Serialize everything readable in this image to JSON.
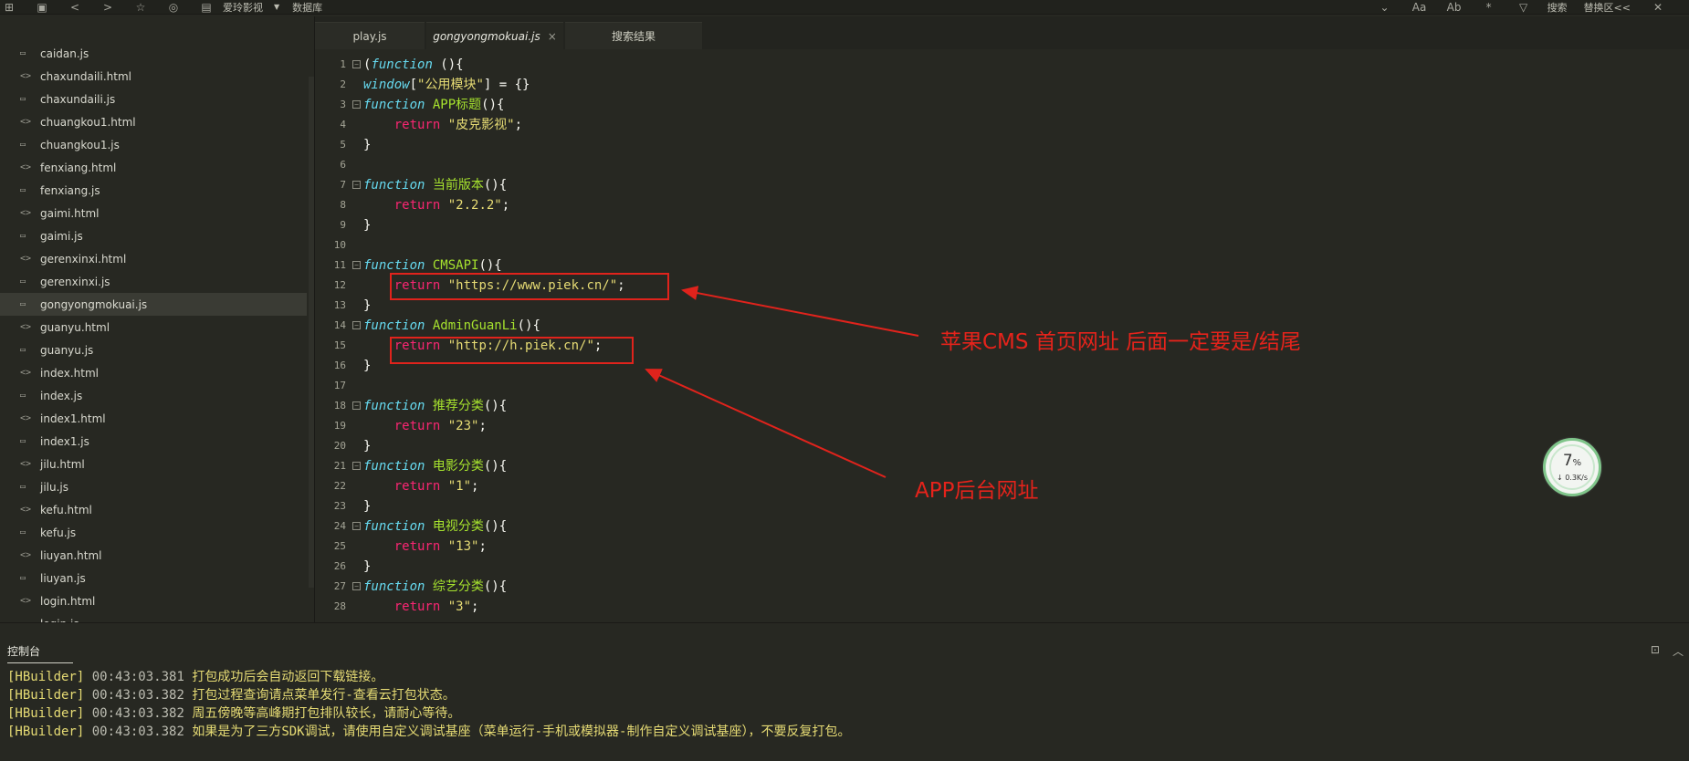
{
  "toolbar": {
    "project_name": "爱玲影视",
    "database_label": "数据库",
    "search_label": "搜索",
    "switch_label": "替换区<<"
  },
  "sidebar": {
    "files": [
      {
        "name": "caidan.js",
        "type": "js",
        "active": false
      },
      {
        "name": "chaxundaili.html",
        "type": "html",
        "active": false
      },
      {
        "name": "chaxundaili.js",
        "type": "js",
        "active": false
      },
      {
        "name": "chuangkou1.html",
        "type": "html",
        "active": false
      },
      {
        "name": "chuangkou1.js",
        "type": "js",
        "active": false
      },
      {
        "name": "fenxiang.html",
        "type": "html",
        "active": false
      },
      {
        "name": "fenxiang.js",
        "type": "js",
        "active": false
      },
      {
        "name": "gaimi.html",
        "type": "html",
        "active": false
      },
      {
        "name": "gaimi.js",
        "type": "js",
        "active": false
      },
      {
        "name": "gerenxinxi.html",
        "type": "html",
        "active": false
      },
      {
        "name": "gerenxinxi.js",
        "type": "js",
        "active": false
      },
      {
        "name": "gongyongmokuai.js",
        "type": "js",
        "active": true
      },
      {
        "name": "guanyu.html",
        "type": "html",
        "active": false
      },
      {
        "name": "guanyu.js",
        "type": "js",
        "active": false
      },
      {
        "name": "index.html",
        "type": "html",
        "active": false
      },
      {
        "name": "index.js",
        "type": "js",
        "active": false
      },
      {
        "name": "index1.html",
        "type": "html",
        "active": false
      },
      {
        "name": "index1.js",
        "type": "js",
        "active": false
      },
      {
        "name": "jilu.html",
        "type": "html",
        "active": false
      },
      {
        "name": "jilu.js",
        "type": "js",
        "active": false
      },
      {
        "name": "kefu.html",
        "type": "html",
        "active": false
      },
      {
        "name": "kefu.js",
        "type": "js",
        "active": false
      },
      {
        "name": "liuyan.html",
        "type": "html",
        "active": false
      },
      {
        "name": "liuyan.js",
        "type": "js",
        "active": false
      },
      {
        "name": "login.html",
        "type": "html",
        "active": false
      },
      {
        "name": "login.js",
        "type": "js",
        "active": false
      }
    ]
  },
  "tabs": [
    {
      "label": "play.js",
      "active": false
    },
    {
      "label": "gongyongmokuai.js",
      "active": true,
      "close": "×"
    },
    {
      "label": "搜索结果",
      "active": false
    }
  ],
  "editor": {
    "lines": [
      {
        "n": "1",
        "fold": true,
        "tokens": [
          {
            "t": "(",
            "c": "pl"
          },
          {
            "t": "function",
            "c": "kw"
          },
          {
            "t": " (){",
            "c": "pl"
          }
        ]
      },
      {
        "n": "2",
        "fold": false,
        "tokens": [
          {
            "t": "window",
            "c": "kw"
          },
          {
            "t": "[",
            "c": "pl"
          },
          {
            "t": "\"公用模块\"",
            "c": "str"
          },
          {
            "t": "] = {}",
            "c": "pl"
          }
        ]
      },
      {
        "n": "3",
        "fold": true,
        "tokens": [
          {
            "t": "function",
            "c": "kw"
          },
          {
            "t": " APP标题",
            "c": "fn"
          },
          {
            "t": "(){",
            "c": "pl"
          }
        ]
      },
      {
        "n": "4",
        "fold": false,
        "tokens": [
          {
            "t": "    return",
            "c": "ret"
          },
          {
            "t": " \"皮克影视\"",
            "c": "str"
          },
          {
            "t": ";",
            "c": "pl"
          }
        ]
      },
      {
        "n": "5",
        "fold": false,
        "tokens": [
          {
            "t": "}",
            "c": "pl"
          }
        ]
      },
      {
        "n": "6",
        "fold": false,
        "tokens": []
      },
      {
        "n": "7",
        "fold": true,
        "tokens": [
          {
            "t": "function",
            "c": "kw"
          },
          {
            "t": " 当前版本",
            "c": "fn"
          },
          {
            "t": "(){",
            "c": "pl"
          }
        ]
      },
      {
        "n": "8",
        "fold": false,
        "tokens": [
          {
            "t": "    return",
            "c": "ret"
          },
          {
            "t": " \"2.2.2\"",
            "c": "str"
          },
          {
            "t": ";",
            "c": "pl"
          }
        ]
      },
      {
        "n": "9",
        "fold": false,
        "tokens": [
          {
            "t": "}",
            "c": "pl"
          }
        ]
      },
      {
        "n": "10",
        "fold": false,
        "tokens": []
      },
      {
        "n": "11",
        "fold": true,
        "tokens": [
          {
            "t": "function",
            "c": "kw"
          },
          {
            "t": " CMSAPI",
            "c": "fn"
          },
          {
            "t": "(){",
            "c": "pl"
          }
        ]
      },
      {
        "n": "12",
        "fold": false,
        "tokens": [
          {
            "t": "    return",
            "c": "ret"
          },
          {
            "t": " \"https://www.piek.cn/\"",
            "c": "str"
          },
          {
            "t": ";",
            "c": "pl"
          }
        ]
      },
      {
        "n": "13",
        "fold": false,
        "tokens": [
          {
            "t": "}",
            "c": "pl"
          }
        ]
      },
      {
        "n": "14",
        "fold": true,
        "tokens": [
          {
            "t": "function",
            "c": "kw"
          },
          {
            "t": " AdminGuanLi",
            "c": "fn"
          },
          {
            "t": "(){",
            "c": "pl"
          }
        ]
      },
      {
        "n": "15",
        "fold": false,
        "tokens": [
          {
            "t": "    return",
            "c": "ret"
          },
          {
            "t": " \"http://h.piek.cn/\"",
            "c": "str"
          },
          {
            "t": ";",
            "c": "pl"
          }
        ]
      },
      {
        "n": "16",
        "fold": false,
        "tokens": [
          {
            "t": "}",
            "c": "pl"
          }
        ]
      },
      {
        "n": "17",
        "fold": false,
        "tokens": []
      },
      {
        "n": "18",
        "fold": true,
        "tokens": [
          {
            "t": "function",
            "c": "kw"
          },
          {
            "t": " 推荐分类",
            "c": "fn"
          },
          {
            "t": "(){",
            "c": "pl"
          }
        ]
      },
      {
        "n": "19",
        "fold": false,
        "tokens": [
          {
            "t": "    return",
            "c": "ret"
          },
          {
            "t": " \"23\"",
            "c": "str"
          },
          {
            "t": ";",
            "c": "pl"
          }
        ]
      },
      {
        "n": "20",
        "fold": false,
        "tokens": [
          {
            "t": "}",
            "c": "pl"
          }
        ]
      },
      {
        "n": "21",
        "fold": true,
        "tokens": [
          {
            "t": "function",
            "c": "kw"
          },
          {
            "t": " 电影分类",
            "c": "fn"
          },
          {
            "t": "(){",
            "c": "pl"
          }
        ]
      },
      {
        "n": "22",
        "fold": false,
        "tokens": [
          {
            "t": "    return",
            "c": "ret"
          },
          {
            "t": " \"1\"",
            "c": "str"
          },
          {
            "t": ";",
            "c": "pl"
          }
        ]
      },
      {
        "n": "23",
        "fold": false,
        "tokens": [
          {
            "t": "}",
            "c": "pl"
          }
        ]
      },
      {
        "n": "24",
        "fold": true,
        "tokens": [
          {
            "t": "function",
            "c": "kw"
          },
          {
            "t": " 电视分类",
            "c": "fn"
          },
          {
            "t": "(){",
            "c": "pl"
          }
        ]
      },
      {
        "n": "25",
        "fold": false,
        "tokens": [
          {
            "t": "    return",
            "c": "ret"
          },
          {
            "t": " \"13\"",
            "c": "str"
          },
          {
            "t": ";",
            "c": "pl"
          }
        ]
      },
      {
        "n": "26",
        "fold": false,
        "tokens": [
          {
            "t": "}",
            "c": "pl"
          }
        ]
      },
      {
        "n": "27",
        "fold": true,
        "tokens": [
          {
            "t": "function",
            "c": "kw"
          },
          {
            "t": " 综艺分类",
            "c": "fn"
          },
          {
            "t": "(){",
            "c": "pl"
          }
        ]
      },
      {
        "n": "28",
        "fold": false,
        "tokens": [
          {
            "t": "    return",
            "c": "ret"
          },
          {
            "t": " \"3\"",
            "c": "str"
          },
          {
            "t": ";",
            "c": "pl"
          }
        ]
      }
    ]
  },
  "annotations": {
    "cms_note": "苹果CMS 首页网址 后面一定要是/结尾",
    "admin_note": "APP后台网址",
    "color": "#e5231b"
  },
  "gauge": {
    "percent": "7",
    "percent_unit": "%",
    "speed": "↓ 0.3K/s"
  },
  "console": {
    "title": "控制台",
    "logs": [
      {
        "tag": "[HBuilder]",
        "time": "00:43:03.381",
        "msg": "打包成功后会自动返回下载链接。"
      },
      {
        "tag": "[HBuilder]",
        "time": "00:43:03.382",
        "msg": "打包过程查询请点菜单发行-查看云打包状态。"
      },
      {
        "tag": "[HBuilder]",
        "time": "00:43:03.382",
        "msg": "周五傍晚等高峰期打包排队较长，请耐心等待。"
      },
      {
        "tag": "[HBuilder]",
        "time": "00:43:03.382",
        "msg": "如果是为了三方SDK调试，请使用自定义调试基座（菜单运行-手机或模拟器-制作自定义调试基座），不要反复打包。"
      }
    ]
  },
  "colors": {
    "background": "#272822",
    "keyword": "#66d9ef",
    "function_name": "#a6e22e",
    "return": "#f92672",
    "string": "#e6db74"
  }
}
